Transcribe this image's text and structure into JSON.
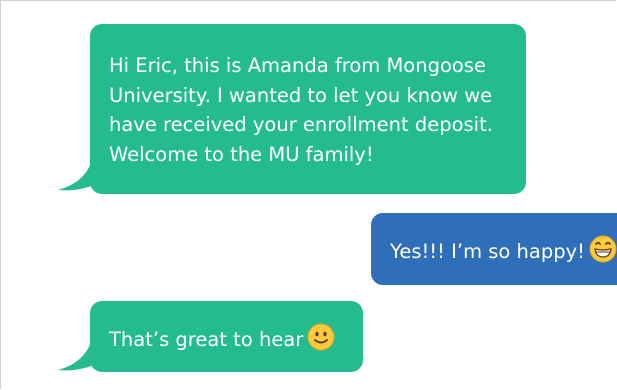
{
  "conversation": {
    "messages": [
      {
        "sender": "Amanda",
        "direction": "incoming",
        "text": "Hi Eric, this is Amanda from Mongoose University. I wanted to let you know we have received your enrollment deposit. Welcome to the MU family!"
      },
      {
        "sender": "Eric",
        "direction": "outgoing",
        "text": "Yes!!! I’m so happy!",
        "emoji": "grinning-face-icon"
      },
      {
        "sender": "Amanda",
        "direction": "incoming",
        "text": "That’s great to hear",
        "emoji": "slightly-smiling-face-icon"
      }
    ]
  },
  "colors": {
    "incoming_bubble": "#24bc8f",
    "outgoing_bubble": "#2f6eb8",
    "text": "#ffffff",
    "emoji_face": "#ffc93d"
  }
}
